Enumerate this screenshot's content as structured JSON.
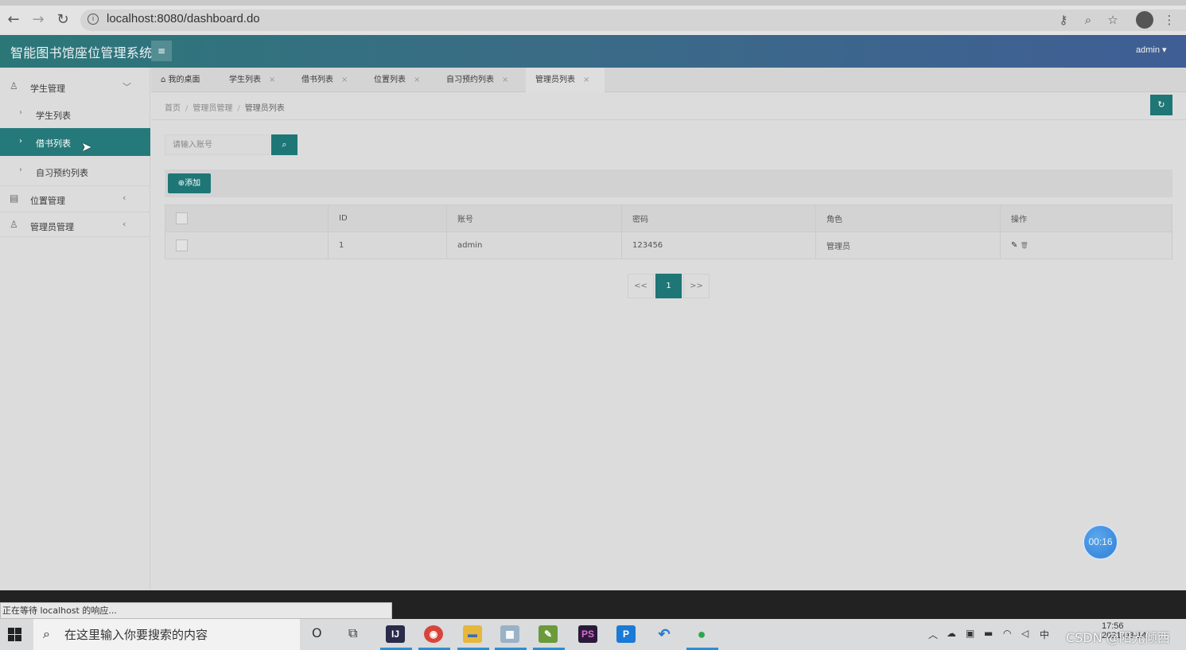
{
  "browser": {
    "url": "localhost:8080/dashboard.do",
    "back_icon": "←",
    "forward_icon": "→",
    "reload_icon": "↻",
    "info_icon": "i",
    "key_icon": "⚷",
    "zoom_icon": "⌕",
    "star_icon": "☆",
    "menu_icon": "⋮"
  },
  "header": {
    "title": "智能图书馆座位管理系统",
    "menu_toggle_icon": "≡",
    "user": "admin ▾"
  },
  "sidebar": {
    "groups": [
      {
        "label": "学生管理",
        "icon": "♙",
        "arrow": "﹀"
      },
      {
        "label": "位置管理",
        "icon": "▤",
        "arrow": "‹"
      },
      {
        "label": "管理员管理",
        "icon": "♙",
        "arrow": "‹"
      }
    ],
    "sub_items": [
      {
        "label": "学生列表",
        "chevron": "›"
      },
      {
        "label": "借书列表",
        "chevron": "›"
      },
      {
        "label": "自习预约列表",
        "chevron": "›"
      }
    ]
  },
  "tabs": [
    {
      "label": "我的桌面",
      "icon": "⌂"
    },
    {
      "label": "学生列表",
      "close": "×"
    },
    {
      "label": "借书列表",
      "close": "×"
    },
    {
      "label": "位置列表",
      "close": "×"
    },
    {
      "label": "自习预约列表",
      "close": "×"
    },
    {
      "label": "管理员列表",
      "close": "×"
    }
  ],
  "breadcrumb": [
    "首页",
    "管理员管理",
    "管理员列表"
  ],
  "breadcrumb_sep": "/",
  "refresh_icon": "↻",
  "search": {
    "placeholder": "请输入账号",
    "button_icon": "⌕"
  },
  "toolbar": {
    "add_label": "⊕添加"
  },
  "table": {
    "headers": [
      "ID",
      "账号",
      "密码",
      "角色",
      "操作"
    ],
    "rows": [
      {
        "id": "1",
        "account": "admin",
        "password": "123456",
        "role": "管理员",
        "edit_icon": "✎",
        "delete_icon": "🗑"
      }
    ]
  },
  "pagination": {
    "prev": "<<",
    "current": "1",
    "next": ">>"
  },
  "timer": "00:16",
  "status_text": "正在等待 localhost 的响应...",
  "taskbar": {
    "search_placeholder": "在这里输入你要搜索的内容",
    "search_icon": "⌕",
    "cortana_icon": "O",
    "taskview_icon": "⧉",
    "apps": [
      "IJ",
      "◉",
      "▬",
      "▦",
      "✎",
      "PS",
      "P",
      "↶",
      "●"
    ],
    "clock_time": "17:56",
    "clock_date": "2021-03-14"
  },
  "watermark": "CSDN @阳光倾西",
  "colors": {
    "accent": "#1e7676",
    "header_start": "#2b7778",
    "header_end": "#3f5e95"
  }
}
